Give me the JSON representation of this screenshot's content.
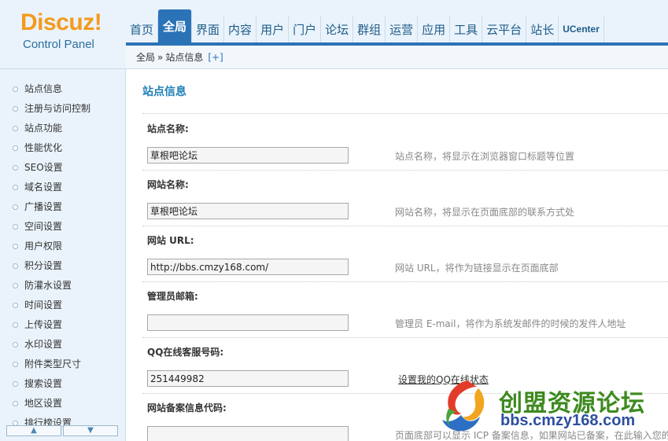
{
  "logo": {
    "brand": "Discuz!",
    "subtitle": "Control Panel"
  },
  "topnav": {
    "items": [
      "首页",
      "全局",
      "界面",
      "内容",
      "用户",
      "门户",
      "论坛",
      "群组",
      "运营",
      "应用",
      "工具",
      "云平台",
      "站长",
      "UCenter"
    ],
    "active": "全局"
  },
  "breadcrumb": {
    "section": "全局",
    "separator": "»",
    "page": "站点信息",
    "toggle": "[+]"
  },
  "sidebar": {
    "items": [
      "站点信息",
      "注册与访问控制",
      "站点功能",
      "性能优化",
      "SEO设置",
      "域名设置",
      "广播设置",
      "空间设置",
      "用户权限",
      "积分设置",
      "防灌水设置",
      "时间设置",
      "上传设置",
      "水印设置",
      "附件类型尺寸",
      "搜索设置",
      "地区设置",
      "排行榜设置"
    ],
    "scroll_up": "▲",
    "scroll_down": "▼"
  },
  "main": {
    "title": "站点信息",
    "settings": [
      {
        "label": "站点名称:",
        "value": "草根吧论坛",
        "desc": "站点名称，将显示在浏览器窗口标题等位置"
      },
      {
        "label": "网站名称:",
        "value": "草根吧论坛",
        "desc": "网站名称，将显示在页面底部的联系方式处"
      },
      {
        "label": "网站 URL:",
        "value": "http://bbs.cmzy168.com/",
        "desc": "网站 URL，将作为链接显示在页面底部"
      },
      {
        "label": "管理员邮箱:",
        "value": "",
        "desc": "管理员 E-mail，将作为系统发邮件的时候的发件人地址"
      },
      {
        "label": "QQ在线客服号码:",
        "value": "251449982",
        "link": "设置我的QQ在线状态"
      },
      {
        "label": "网站备案信息代码:",
        "value": "",
        "desc": "页面底部可以显示 ICP 备案信息，如果网站已备案，在此输入您的"
      }
    ]
  },
  "watermark": {
    "title": "创盟资源论坛",
    "url": "bbs.cmzy168.com"
  },
  "colors": {
    "accent": "#2b73b7",
    "logo_orange": "#f39a1e",
    "title_blue": "#1f7fb5",
    "panel_bg": "#eaf3fb"
  }
}
